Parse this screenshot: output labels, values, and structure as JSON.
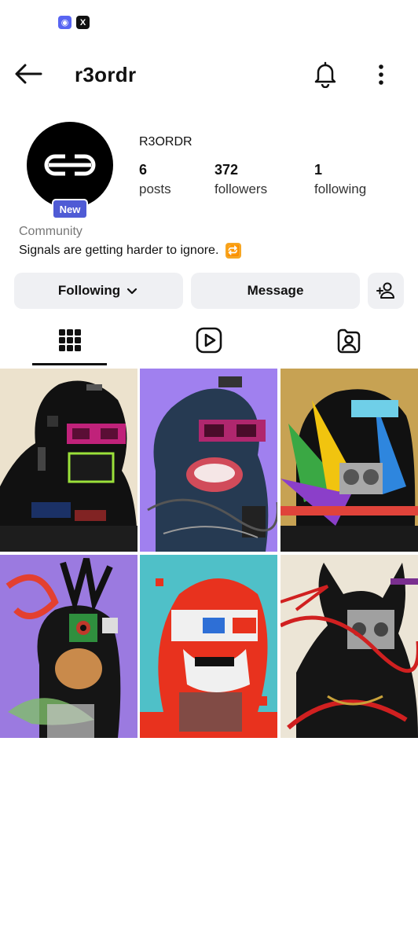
{
  "status_bar": {
    "icons": [
      "discord-icon",
      "x-icon"
    ],
    "discord_glyph": "◉",
    "x_glyph": "X"
  },
  "header": {
    "username": "r3ordr",
    "back_icon": "arrow-left-icon",
    "bell_icon": "bell-icon",
    "more_icon": "more-vertical-icon"
  },
  "profile": {
    "display_name": "R3ORDR",
    "badge": "New",
    "stats": [
      {
        "value": "6",
        "label": "posts"
      },
      {
        "value": "372",
        "label": "followers"
      },
      {
        "value": "1",
        "label": "following"
      }
    ],
    "category": "Community",
    "bio": "Signals are getting harder to ignore.",
    "bio_emoji": "🔁"
  },
  "actions": {
    "following_label": "Following",
    "message_label": "Message",
    "add_user_icon": "person-add-icon"
  },
  "tabs": [
    {
      "name": "grid",
      "icon": "grid-icon",
      "active": true
    },
    {
      "name": "reels",
      "icon": "reels-icon",
      "active": false
    },
    {
      "name": "tagged",
      "icon": "tagged-icon",
      "active": false
    }
  ],
  "posts": [
    {
      "bg": "#ece2cd",
      "accent": "#c0227a",
      "figure": "#111111"
    },
    {
      "bg": "#a080ef",
      "accent": "#b0276e",
      "figure": "#263a52"
    },
    {
      "bg": "#c7a253",
      "accent": "#e0433a",
      "figure": "#111111"
    },
    {
      "bg": "#9b7ae0",
      "accent": "#e34030",
      "figure": "#151515"
    },
    {
      "bg": "#4fc0c8",
      "accent": "#e8321e",
      "figure": "#f0f0f0"
    },
    {
      "bg": "#ece5d6",
      "accent": "#d02020",
      "figure": "#151515"
    }
  ],
  "colors": {
    "accent_badge": "#4f5bd5",
    "button_bg": "#eff0f3",
    "text_primary": "#111111",
    "text_secondary": "#777777"
  }
}
